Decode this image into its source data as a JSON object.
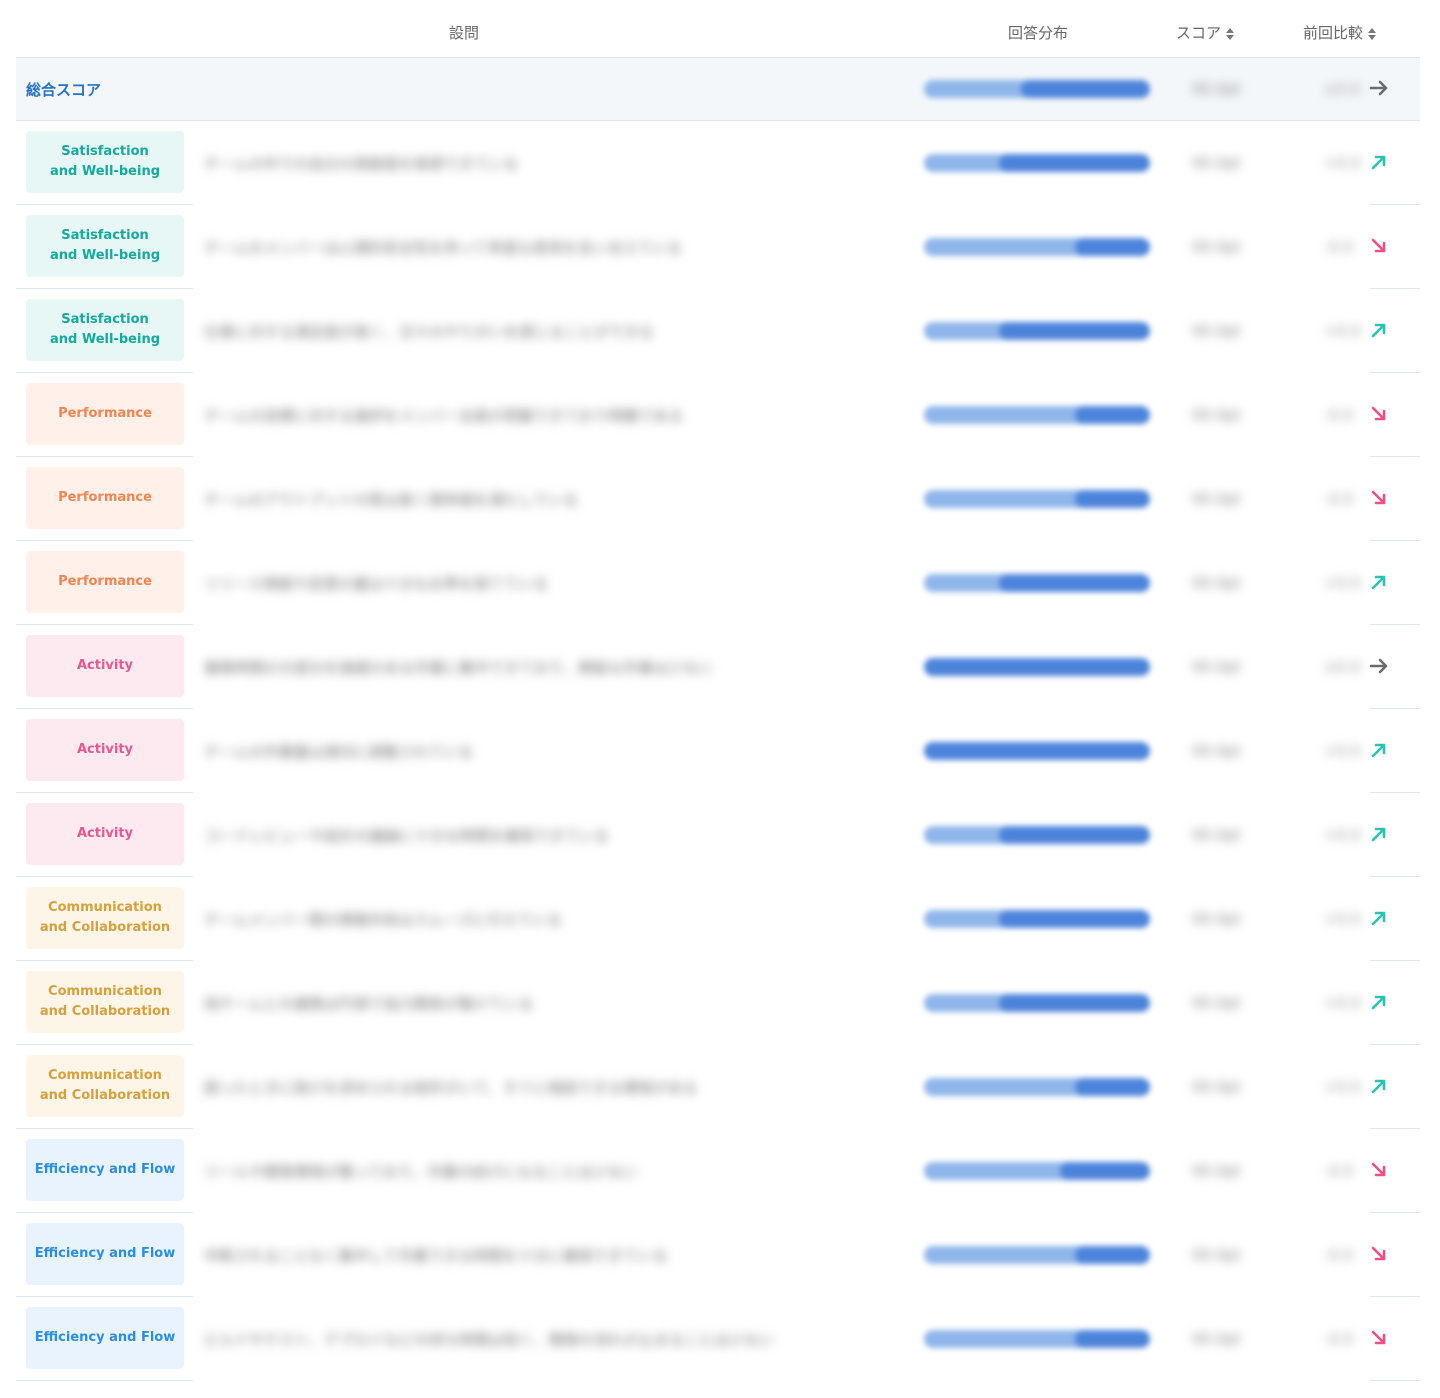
{
  "header": {
    "question": "設問",
    "distribution": "回答分布",
    "score": "スコア",
    "previous": "前回比較"
  },
  "colors": {
    "up": "#27c4b4",
    "down": "#ef4f86",
    "flat": "#6b6b6b",
    "bar_light": "#8fb6ea",
    "bar_dark": "#4d84db"
  },
  "total": {
    "label": "総合スコア",
    "question": "",
    "score": "00.0pt",
    "previous": "±0.0",
    "distribution": 0.57,
    "trend": "flat"
  },
  "rows": [
    {
      "category": "Satisfaction\nand Well-being",
      "type": "sat",
      "question": "チームの中での自分の貢献度を実感できている",
      "score": "00.0pt",
      "previous": "+0.0",
      "distribution": 0.67,
      "trend": "up"
    },
    {
      "category": "Satisfaction\nand Well-being",
      "type": "sat",
      "question": "チームのメンバーは心理的安全性を持って率直な意見を言い合えている",
      "score": "00.0pt",
      "previous": "-0.0",
      "distribution": 0.33,
      "trend": "down"
    },
    {
      "category": "Satisfaction\nand Well-being",
      "type": "sat",
      "question": "仕事に対する満足度が高く、日々のやりがいを感じることができる",
      "score": "00.0pt",
      "previous": "+0.0",
      "distribution": 0.67,
      "trend": "up"
    },
    {
      "category": "Performance",
      "type": "perf",
      "question": "チームの目標に対する進捗をメンバー全員が把握できており明確である",
      "score": "00.0pt",
      "previous": "-0.0",
      "distribution": 0.33,
      "trend": "down"
    },
    {
      "category": "Performance",
      "type": "perf",
      "question": "チームのアウトプットの質は高く期待値を満たしている",
      "score": "00.0pt",
      "previous": "-0.0",
      "distribution": 0.33,
      "trend": "down"
    },
    {
      "category": "Performance",
      "type": "perf",
      "question": "リリース頻度や変更の量は十分な水準を保てている",
      "score": "00.0pt",
      "previous": "+0.0",
      "distribution": 0.67,
      "trend": "up"
    },
    {
      "category": "Activity",
      "type": "act",
      "question": "業務時間の大部分を価値のある作業に集中できており、無駄な作業は少ない",
      "score": "00.0pt",
      "previous": "±0.0",
      "distribution": 1.0,
      "trend": "flat"
    },
    {
      "category": "Activity",
      "type": "act",
      "question": "チームの作業量は適切に調整されている",
      "score": "00.0pt",
      "previous": "+0.0",
      "distribution": 1.0,
      "trend": "up"
    },
    {
      "category": "Activity",
      "type": "act",
      "question": "コードレビューや設計の議論に十分な時間を確保できている",
      "score": "00.0pt",
      "previous": "+0.0",
      "distribution": 0.67,
      "trend": "up"
    },
    {
      "category": "Communication\nand Collaboration",
      "type": "comm",
      "question": "チームメンバー間の情報共有はスムーズに行えている",
      "score": "00.0pt",
      "previous": "+0.0",
      "distribution": 0.67,
      "trend": "up"
    },
    {
      "category": "Communication\nand Collaboration",
      "type": "comm",
      "question": "他チームとの連携は円滑で協力関係が築けている",
      "score": "00.0pt",
      "previous": "+0.0",
      "distribution": 0.67,
      "trend": "up"
    },
    {
      "category": "Communication\nand Collaboration",
      "type": "comm",
      "question": "困ったときに助けを求められる相手がいて、すぐに相談できる環境がある",
      "score": "00.0pt",
      "previous": "+0.0",
      "distribution": 0.33,
      "trend": "up"
    },
    {
      "category": "Efficiency and Flow",
      "type": "eff",
      "question": "ツールや開発環境が整っており、作業の妨げになることは少ない",
      "score": "00.0pt",
      "previous": "-0.0",
      "distribution": 0.4,
      "trend": "down"
    },
    {
      "category": "Efficiency and Flow",
      "type": "eff",
      "question": "中断されることなく集中して作業できる時間を十分に確保できている",
      "score": "00.0pt",
      "previous": "-0.0",
      "distribution": 0.33,
      "trend": "down"
    },
    {
      "category": "Efficiency and Flow",
      "type": "eff",
      "question": "ビルドやテスト、デプロイなどの待ち時間は短く、開発の流れが止まることは少ない",
      "score": "00.0pt",
      "previous": "-0.0",
      "distribution": 0.33,
      "trend": "down"
    }
  ]
}
